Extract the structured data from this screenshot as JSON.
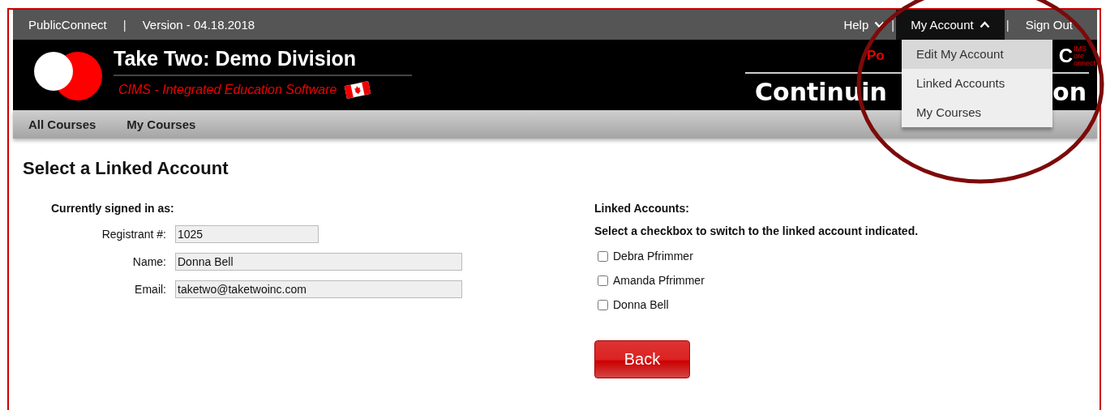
{
  "top_bar": {
    "left": [
      {
        "kind": "link",
        "text": "PublicConnect"
      },
      {
        "kind": "separator",
        "text": "|"
      },
      {
        "kind": "text",
        "text": "Version - 04.18.2018"
      }
    ],
    "right": [
      {
        "kind": "menu",
        "text": "Help",
        "expanded": false
      },
      {
        "kind": "separator",
        "text": "|"
      },
      {
        "kind": "menu",
        "text": "My Account",
        "expanded": true
      },
      {
        "kind": "separator",
        "text": "|"
      },
      {
        "kind": "link",
        "text": "Sign Out"
      }
    ]
  },
  "account_menu": {
    "items": [
      {
        "label": "Edit My Account",
        "selected": true
      },
      {
        "label": "Linked Accounts",
        "selected": false
      },
      {
        "label": "My Courses",
        "selected": false
      }
    ]
  },
  "banner": {
    "title": "Take Two: Demo Division",
    "subtitle": "CIMS - Integrated Education Software",
    "tagline": "Po",
    "logo_letter": "C",
    "logo_lines": [
      "IMS",
      "ore",
      "onnect"
    ],
    "right_title_start": "Continuin",
    "right_title_end": "on"
  },
  "nav": [
    "All Courses",
    "My Courses"
  ],
  "page": {
    "heading": "Select a Linked Account",
    "signed_in": {
      "heading": "Currently signed in as:",
      "fields": [
        {
          "label": "Registrant #:",
          "value": "1025",
          "kind": "short"
        },
        {
          "label": "Name:",
          "value": "Donna Bell",
          "kind": "long"
        },
        {
          "label": "Email:",
          "value": "taketwo@taketwoinc.com",
          "kind": "long"
        }
      ]
    },
    "linked": {
      "heading": "Linked Accounts:",
      "instruction": "Select a checkbox to switch to the linked account indicated.",
      "accounts": [
        {
          "name": "Debra Pfrimmer",
          "checked": false
        },
        {
          "name": "Amanda Pfrimmer",
          "checked": false
        },
        {
          "name": "Donna Bell",
          "checked": false
        }
      ]
    },
    "back_button": "Back"
  }
}
